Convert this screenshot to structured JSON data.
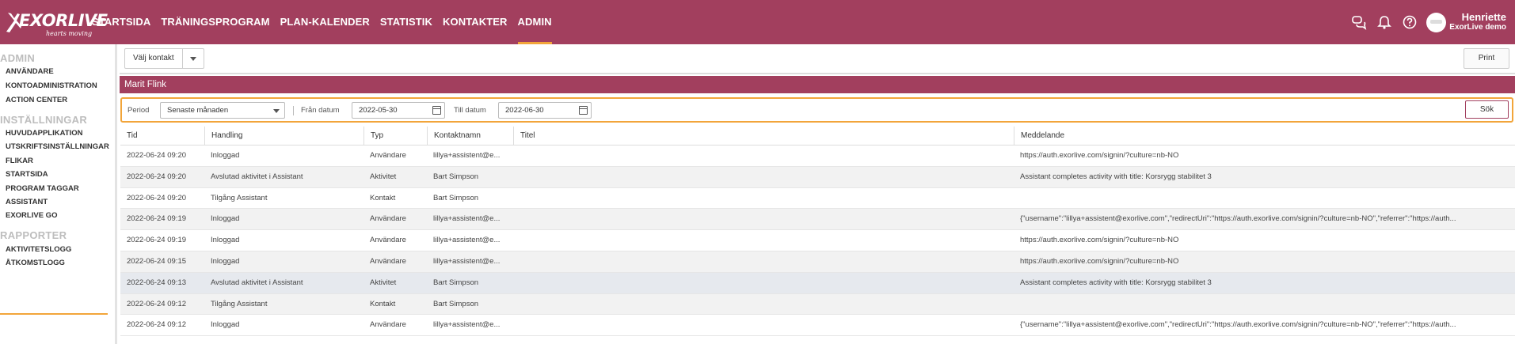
{
  "brand": {
    "name": "EXORLIVE",
    "tagline": "hearts moving"
  },
  "nav": [
    {
      "label": "STARTSIDA",
      "active": false
    },
    {
      "label": "TRÄNINGSPROGRAM",
      "active": false
    },
    {
      "label": "PLAN-KALENDER",
      "active": false
    },
    {
      "label": "STATISTIK",
      "active": false
    },
    {
      "label": "KONTAKTER",
      "active": false
    },
    {
      "label": "ADMIN",
      "active": true
    }
  ],
  "header_icons": [
    "chat-icon",
    "bell-icon",
    "help-icon"
  ],
  "user": {
    "name": "Henriette",
    "org": "ExorLive demo"
  },
  "sidebar": {
    "admin": {
      "title": "ADMIN",
      "items": [
        "ANVÄNDARE",
        "KONTOADMINISTRATION",
        "ACTION CENTER"
      ]
    },
    "settings": {
      "title": "INSTÄLLNINGAR",
      "items": [
        "HUVUDAPPLIKATION",
        "UTSKRIFTSINSTÄLLNINGAR",
        "FLIKAR",
        "STARTSIDA",
        "PROGRAM TAGGAR",
        "ASSISTANT",
        "EXORLIVE GO"
      ]
    },
    "reports": {
      "title": "RAPPORTER",
      "items": [
        "AKTIVITETSLOGG",
        "ÅTKOMSTLOGG"
      ],
      "active": "ÅTKOMSTLOGG"
    }
  },
  "toolbar": {
    "contact_label": "Välj kontakt",
    "print_label": "Print"
  },
  "contact_title": "Marit Flink",
  "filter": {
    "period_label": "Period",
    "period_value": "Senaste månaden",
    "from_label": "Från datum",
    "from_value": "2022-05-30",
    "to_label": "Till datum",
    "to_value": "2022-06-30",
    "search_label": "Sök"
  },
  "table": {
    "columns": [
      "Tid",
      "Handling",
      "Typ",
      "Kontaktnamn",
      "Titel",
      "Meddelande"
    ],
    "rows": [
      [
        "2022-06-24 09:20",
        "Inloggad",
        "Användare",
        "lillya+assistent@e...",
        "",
        "https://auth.exorlive.com/signin/?culture=nb-NO"
      ],
      [
        "2022-06-24 09:20",
        "Avslutad aktivitet i Assistant",
        "Aktivitet",
        "Bart Simpson",
        "",
        "Assistant completes activity with title: Korsrygg stabilitet 3"
      ],
      [
        "2022-06-24 09:20",
        "Tilgång Assistant",
        "Kontakt",
        "Bart Simpson",
        "",
        ""
      ],
      [
        "2022-06-24 09:19",
        "Inloggad",
        "Användare",
        "lillya+assistent@e...",
        "",
        "{\"username\":\"lillya+assistent@exorlive.com\",\"redirectUri\":\"https://auth.exorlive.com/signin/?culture=nb-NO\",\"referrer\":\"https://auth..."
      ],
      [
        "2022-06-24 09:19",
        "Inloggad",
        "Användare",
        "lillya+assistent@e...",
        "",
        "https://auth.exorlive.com/signin/?culture=nb-NO"
      ],
      [
        "2022-06-24 09:15",
        "Inloggad",
        "Användare",
        "lillya+assistent@e...",
        "",
        "https://auth.exorlive.com/signin/?culture=nb-NO"
      ],
      [
        "2022-06-24 09:13",
        "Avslutad aktivitet i Assistant",
        "Aktivitet",
        "Bart Simpson",
        "",
        "Assistant completes activity with title: Korsrygg stabilitet 3"
      ],
      [
        "2022-06-24 09:12",
        "Tilgång Assistant",
        "Kontakt",
        "Bart Simpson",
        "",
        ""
      ],
      [
        "2022-06-24 09:12",
        "Inloggad",
        "Användare",
        "lillya+assistent@e...",
        "",
        "{\"username\":\"lillya+assistent@exorlive.com\",\"redirectUri\":\"https://auth.exorlive.com/signin/?culture=nb-NO\",\"referrer\":\"https://auth..."
      ]
    ]
  },
  "colors": {
    "brand": "#a23f5e",
    "accent": "#f2a53a"
  }
}
